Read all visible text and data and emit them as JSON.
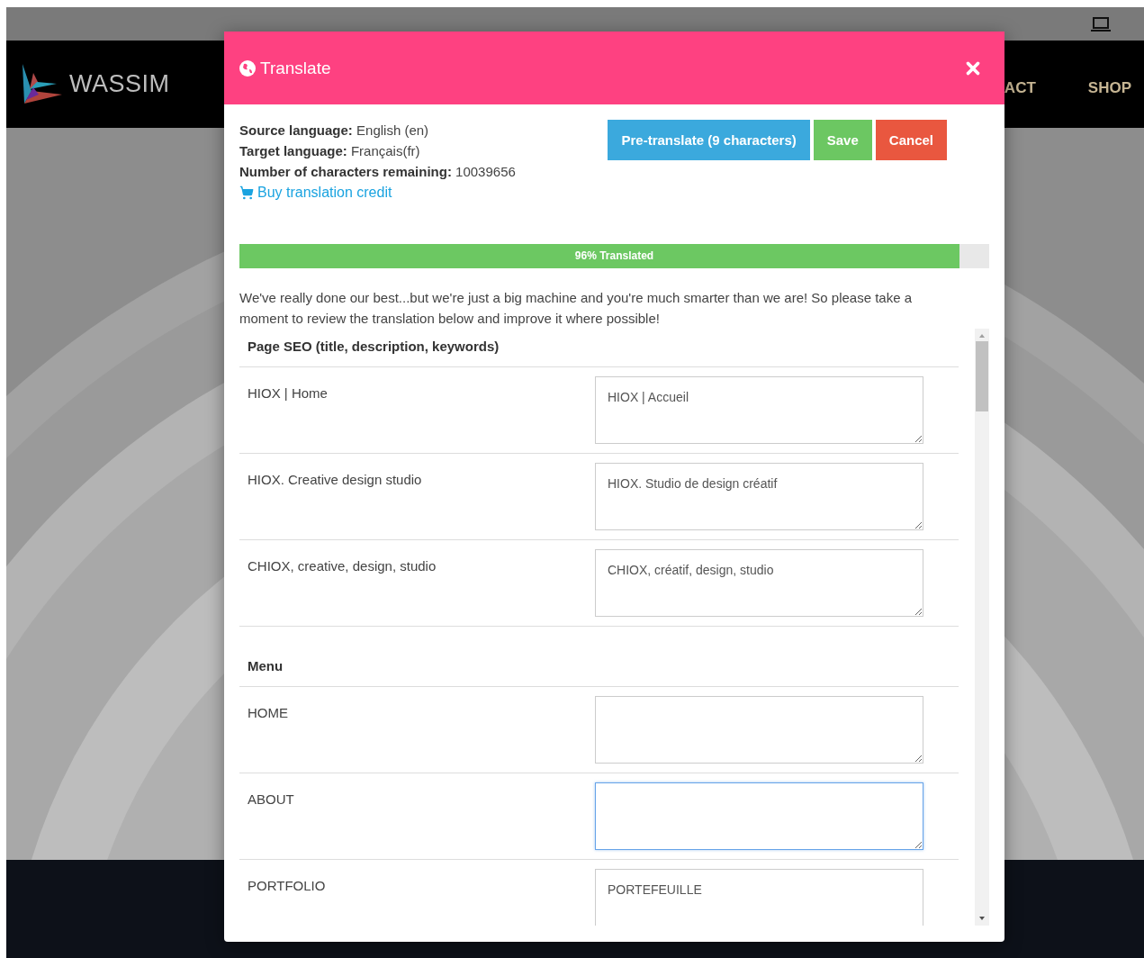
{
  "site": {
    "logo": "WASSIM",
    "nav": [
      "ACT",
      "SHOP"
    ]
  },
  "dialog": {
    "title": "Translate",
    "info": [
      {
        "label": "Source language:",
        "value": "English (en)"
      },
      {
        "label": "Target language:",
        "value": "Français(fr)"
      },
      {
        "label": "Number of characters remaining:",
        "value": "10039656"
      }
    ],
    "credit_link": "Buy translation credit",
    "buttons": [
      {
        "label": "Pre-translate (9 characters)",
        "kind": "info"
      },
      {
        "label": "Save",
        "kind": "success"
      },
      {
        "label": "Cancel",
        "kind": "danger"
      }
    ],
    "progress": {
      "label": "96% Translated",
      "level": 0.96
    },
    "intro": "We've really done our best...but we're just a big machine and you're much smarter than we are! So please take a moment to review the translation below and improve it where possible!",
    "sections": [
      {
        "title": "Page SEO (title, description, keywords)",
        "rows": [
          {
            "source": "HIOX | Home",
            "translation": "HIOX | Accueil",
            "focused": false
          },
          {
            "source": "HIOX. Creative design studio",
            "translation": "HIOX. Studio de design créatif",
            "focused": false
          },
          {
            "source": "CHIOX, creative, design, studio",
            "translation": "CHIOX, créatif, design, studio",
            "focused": false
          }
        ]
      },
      {
        "title": "Menu",
        "rows": [
          {
            "source": "HOME",
            "focused": false
          },
          {
            "source": "ABOUT",
            "focused": true
          },
          {
            "source": "PORTFOLIO",
            "translation": "PORTEFEUILLE",
            "focused": false
          }
        ]
      }
    ]
  }
}
